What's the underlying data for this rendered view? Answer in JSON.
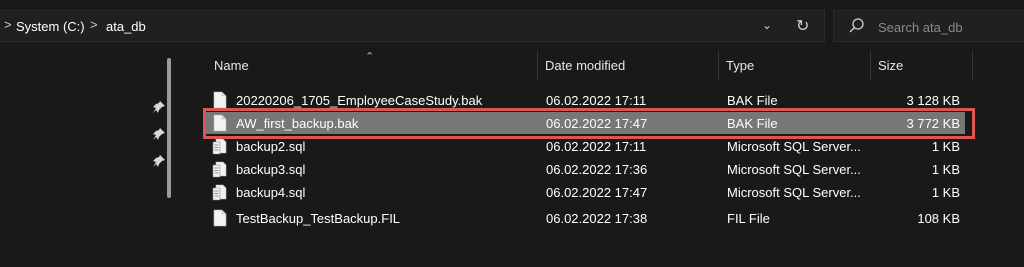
{
  "address": {
    "breadcrumbs": [
      "System (C:)",
      "ata_db"
    ],
    "separator": ">"
  },
  "search": {
    "placeholder": "Search ata_db"
  },
  "columns": {
    "name": "Name",
    "date_modified": "Date modified",
    "type": "Type",
    "size": "Size"
  },
  "files": [
    {
      "name": "20220206_1705_EmployeeCaseStudy.bak",
      "date": "06.02.2022 17:11",
      "type": "BAK File",
      "size": "3 128 KB",
      "icon": "file-icon"
    },
    {
      "name": "AW_first_backup.bak",
      "date": "06.02.2022 17:47",
      "type": "BAK File",
      "size": "3 772 KB",
      "icon": "file-icon",
      "selected": true
    },
    {
      "name": "backup2.sql",
      "date": "06.02.2022 17:11",
      "type": "Microsoft SQL Server...",
      "size": "1 KB",
      "icon": "sql-file-icon"
    },
    {
      "name": "backup3.sql",
      "date": "06.02.2022 17:36",
      "type": "Microsoft SQL Server...",
      "size": "1 KB",
      "icon": "sql-file-icon"
    },
    {
      "name": "backup4.sql",
      "date": "06.02.2022 17:47",
      "type": "Microsoft SQL Server...",
      "size": "1 KB",
      "icon": "sql-file-icon"
    },
    {
      "name": "TestBackup_TestBackup.FIL",
      "date": "06.02.2022 17:38",
      "type": "FIL File",
      "size": "108 KB",
      "icon": "file-icon"
    }
  ],
  "colors": {
    "background": "#191919",
    "selection": "#777777",
    "highlight_border": "#e05352"
  }
}
